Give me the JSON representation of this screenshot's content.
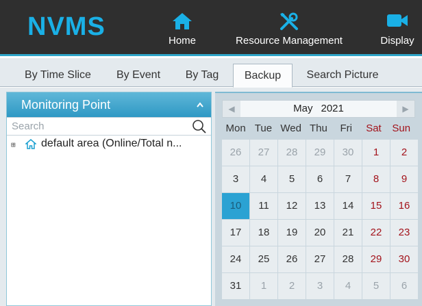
{
  "app": {
    "logo": "NVMS",
    "accent": "#1ab0e6"
  },
  "nav": {
    "home": {
      "label": "Home",
      "icon": "home-icon"
    },
    "resource": {
      "label": "Resource Management",
      "icon": "tools-icon"
    },
    "display": {
      "label": "Display",
      "icon": "video-camera-icon"
    }
  },
  "tabs": [
    {
      "label": "By Time Slice"
    },
    {
      "label": "By Event"
    },
    {
      "label": "By Tag"
    },
    {
      "label": "Backup",
      "active": true
    },
    {
      "label": "Search Picture"
    }
  ],
  "left_panel": {
    "title": "Monitoring Point",
    "search_placeholder": "Search",
    "tree": [
      {
        "label": "default area (Online/Total n...",
        "icon": "home-icon",
        "expander": "⊞"
      }
    ]
  },
  "calendar": {
    "month": "May",
    "year": "2021",
    "weekdays": [
      "Mon",
      "Tue",
      "Wed",
      "Thu",
      "Fri",
      "Sat",
      "Sun"
    ],
    "weeks": [
      [
        "26",
        "27",
        "28",
        "29",
        "30",
        "1",
        "2"
      ],
      [
        "3",
        "4",
        "5",
        "6",
        "7",
        "8",
        "9"
      ],
      [
        "10",
        "11",
        "12",
        "13",
        "14",
        "15",
        "16"
      ],
      [
        "17",
        "18",
        "19",
        "20",
        "21",
        "22",
        "23"
      ],
      [
        "24",
        "25",
        "26",
        "27",
        "28",
        "29",
        "30"
      ],
      [
        "31",
        "1",
        "2",
        "3",
        "4",
        "5",
        "6"
      ]
    ],
    "selected": "10",
    "weekend_color": "#a3131b",
    "selected_color": "#2ba2d3"
  }
}
